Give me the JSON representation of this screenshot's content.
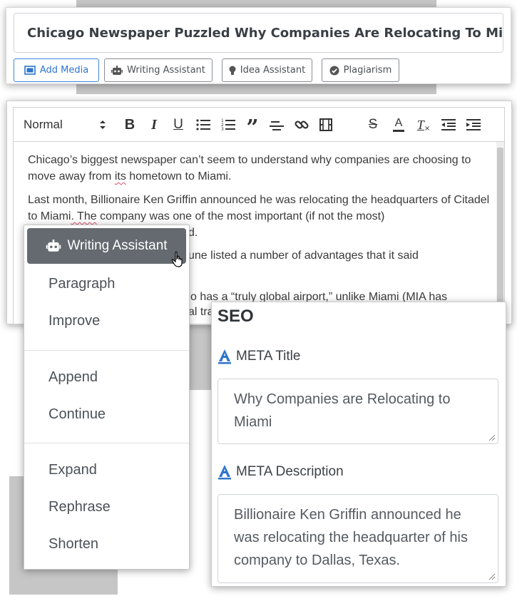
{
  "title_field": {
    "value": "Chicago Newspaper Puzzled Why Companies Are Relocating To Miami"
  },
  "toolbar_buttons": {
    "add_media": "Add Media",
    "writing_assistant": "Writing Assistant",
    "idea_assistant": "Idea Assistant",
    "plagiarism": "Plagiarism"
  },
  "editor": {
    "format_select": "Normal",
    "tool_icons": [
      "bold-icon",
      "italic-icon",
      "underline-icon",
      "bullet-list-icon",
      "ordered-list-icon",
      "blockquote-icon",
      "align-icon",
      "link-icon",
      "video-icon",
      "strikethrough-icon",
      "text-color-icon",
      "clear-format-icon",
      "outdent-icon",
      "indent-icon"
    ],
    "tool_glyphs": {
      "bold": "B",
      "italic": "I",
      "underline": "U",
      "quote": "”",
      "strike": "S",
      "color": "A",
      "clear": "T"
    },
    "paragraphs": {
      "p1_before": "Chicago’s biggest newspaper can’t seem to understand why companies are choosing to move away from ",
      "p1_flag": "its",
      "p1_after": " hometown to Miami.",
      "p2_before": "Last month, Billionaire Ken Griffin announced he was relocating the headquarters of Citadel to Miami",
      "p2_flag": ". The",
      "p2_after": " company was one of the most important (if not the most)",
      "p2_tail": "d.",
      "p3_frag": "une listed a number of advantages that it said",
      "p4_frag": "o has a “truly global airport,” unlike Miami (MIA has",
      "p4_frag2": "al tra"
    }
  },
  "dropdown": {
    "header": "Writing Assistant",
    "items": [
      "Paragraph",
      "Improve",
      "Append",
      "Continue",
      "Expand",
      "Rephrase",
      "Shorten"
    ]
  },
  "seo": {
    "heading": "SEO",
    "meta_title_label": "META Title",
    "meta_title_value": "Why Companies are Relocating to Miami",
    "meta_description_label": "META Description",
    "meta_description_value": "Billionaire Ken Griffin announced he was relocating the headquarter of his company to Dallas, Texas."
  },
  "colors": {
    "accent": "#2e74cc",
    "assistant_header": "#646a70",
    "spell_underline": "#e24b6b"
  }
}
